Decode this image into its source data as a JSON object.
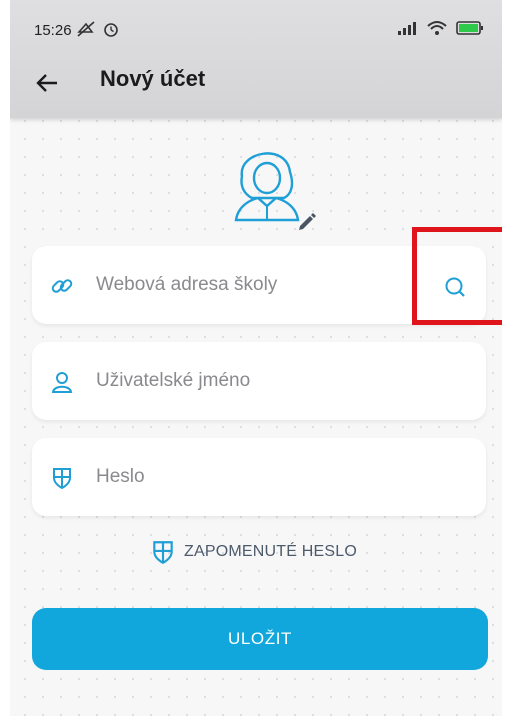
{
  "status_bar": {
    "time": "15:26"
  },
  "header": {
    "title": "Nový účet"
  },
  "form": {
    "school_url": {
      "placeholder": "Webová adresa školy"
    },
    "username": {
      "placeholder": "Uživatelské jméno"
    },
    "password": {
      "placeholder": "Heslo"
    }
  },
  "forgot_password_label": "ZAPOMENUTÉ HESLO",
  "save_label": "ULOŽIT",
  "colors": {
    "accent": "#12a7dc",
    "highlight": "#e0151b",
    "icon": "#1f9fd6"
  }
}
